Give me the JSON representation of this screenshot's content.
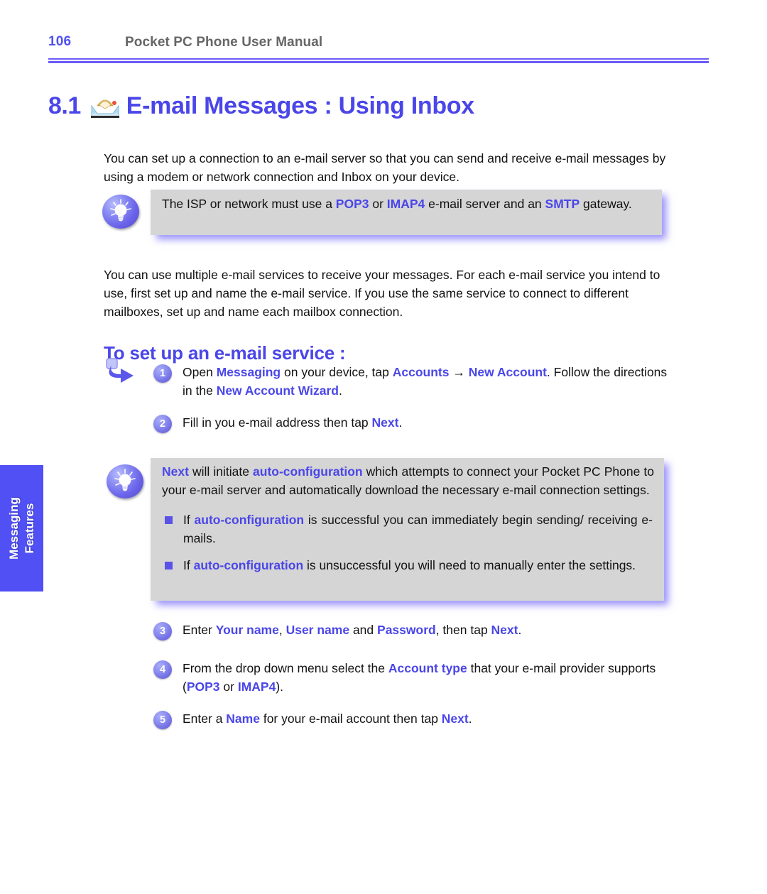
{
  "header": {
    "page_number": "106",
    "title": "Pocket PC Phone User Manual"
  },
  "chapter": {
    "number": "8.1",
    "icon": "inbox-icon",
    "heading": "E-mail Messages : Using Inbox"
  },
  "intro_paragraph": "You can set up a connection to an e-mail server so that you can send and receive e-mail messages by using a modem or network connection and Inbox on your device.",
  "tip_1": {
    "icon": "lightbulb-icon",
    "text_parts": [
      {
        "t": "The ISP or network must use a ",
        "k": false
      },
      {
        "t": "POP3",
        "k": true
      },
      {
        "t": " or ",
        "k": false
      },
      {
        "t": "IMAP4",
        "k": true
      },
      {
        "t": " e-mail server and an ",
        "k": false
      },
      {
        "t": "SMTP",
        "k": true
      },
      {
        "t": " gateway.",
        "k": false
      }
    ]
  },
  "services_paragraph": "You can use multiple e-mail services to receive your messages. For each e-mail service you intend to use, first set up and name the e-mail service. If you use the same service to connect to different mailboxes, set up and name each mailbox connection.",
  "section_heading": "To set up an e-mail service :",
  "steps": [
    {
      "number": "1",
      "parts": [
        {
          "t": "Open ",
          "k": false
        },
        {
          "t": "Messaging",
          "k": true
        },
        {
          "t": " on your device, tap ",
          "k": false
        },
        {
          "t": "Accounts",
          "k": true
        },
        {
          "t": " → ",
          "k": false
        },
        {
          "t": "New Account",
          "k": true
        },
        {
          "t": ". Follow the directions in the ",
          "k": false
        },
        {
          "t": "New Account  Wizard",
          "k": true
        },
        {
          "t": ".",
          "k": false
        }
      ]
    },
    {
      "number": "2",
      "parts": [
        {
          "t": "Fill in you e-mail address then tap ",
          "k": false
        },
        {
          "t": "Next",
          "k": true
        },
        {
          "t": ".",
          "k": false
        }
      ]
    },
    {
      "number": "3",
      "parts": [
        {
          "t": "Enter ",
          "k": false
        },
        {
          "t": "Your name",
          "k": true
        },
        {
          "t": ", ",
          "k": false
        },
        {
          "t": "User name",
          "k": true
        },
        {
          "t": " and ",
          "k": false
        },
        {
          "t": "Password",
          "k": true
        },
        {
          "t": ", then tap ",
          "k": false
        },
        {
          "t": "Next",
          "k": true
        },
        {
          "t": ".",
          "k": false
        }
      ]
    },
    {
      "number": "4",
      "parts": [
        {
          "t": "From the drop down menu select the ",
          "k": false
        },
        {
          "t": "Account type",
          "k": true
        },
        {
          "t": " that your e-mail provider supports (",
          "k": false
        },
        {
          "t": "POP3",
          "k": true
        },
        {
          "t": " or ",
          "k": false
        },
        {
          "t": "IMAP4",
          "k": true
        },
        {
          "t": ").",
          "k": false
        }
      ]
    },
    {
      "number": "5",
      "parts": [
        {
          "t": "Enter a ",
          "k": false
        },
        {
          "t": "Name",
          "k": true
        },
        {
          "t": " for your e-mail account then tap ",
          "k": false
        },
        {
          "t": "Next",
          "k": true
        },
        {
          "t": ".",
          "k": false
        }
      ]
    }
  ],
  "tip_2": {
    "icon": "lightbulb-icon",
    "intro_parts": [
      {
        "t": "Next",
        "k": true
      },
      {
        "t": " will initiate ",
        "k": false
      },
      {
        "t": "auto-configuration",
        "k": true
      },
      {
        "t": "  which attempts to connect your Pocket PC Phone to your e-mail server and automatically download the necessary e-mail connection settings.",
        "k": false
      }
    ],
    "bullets": [
      [
        {
          "t": "If ",
          "k": false
        },
        {
          "t": "auto-configuration",
          "k": true
        },
        {
          "t": " is successful you can immediately  begin sending/ receiving e-mails.",
          "k": false
        }
      ],
      [
        {
          "t": "If ",
          "k": false
        },
        {
          "t": "auto-configuration",
          "k": true
        },
        {
          "t": " is unsuccessful you will need to manually enter the settings.",
          "k": false
        }
      ]
    ]
  },
  "side_tab": {
    "line1": "Messaging",
    "line2": "Features"
  },
  "colors": {
    "accent": "#4a46e8",
    "header_rule": "#6b5cf5",
    "tab_bg": "#5050f5",
    "tip_bg": "#d5d5d5",
    "header_title_gray": "#666666"
  }
}
